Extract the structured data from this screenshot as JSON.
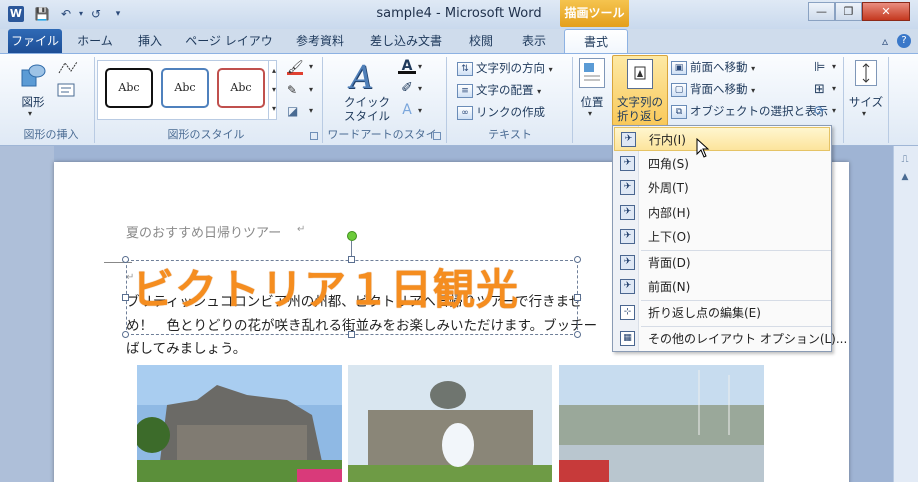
{
  "window": {
    "title": "sample4 - Microsoft Word",
    "contextual_tab_group": "描画ツール",
    "app_icon_label": "W",
    "colors": {
      "ribbon_accent": "#2b579a",
      "contextual": "#f0b232",
      "wordart": "#f58d1f",
      "menu_highlight": "#fce49c"
    }
  },
  "tabs": [
    "ファイル",
    "ホーム",
    "挿入",
    "ページ レイアウト",
    "参考資料",
    "差し込み文書",
    "校閲",
    "表示",
    "書式"
  ],
  "ribbon": {
    "insert_shapes": {
      "shapes_label": "図形",
      "group_label": "図形の挿入"
    },
    "shape_styles": {
      "samples": [
        "Abc",
        "Abc",
        "Abc"
      ],
      "group_label": "図形のスタイル"
    },
    "wordart_styles": {
      "quick_styles_label": "クイック\nスタイル",
      "quick_line1": "クイック",
      "quick_line2": "スタイル",
      "group_label": "ワードアートのスタイル"
    },
    "text": {
      "text_direction": "文字列の方向",
      "align_text": "文字の配置",
      "create_link": "リンクの作成",
      "group_label": "テキスト"
    },
    "arrange": {
      "position": "位置",
      "wrap_text_line1": "文字列の",
      "wrap_text_line2": "折り返し",
      "bring_forward": "前面へ移動",
      "send_backward": "背面へ移動",
      "selection_pane": "オブジェクトの選択と表示"
    },
    "size": {
      "label": "サイズ"
    }
  },
  "document": {
    "subtitle": "夏のおすすめ日帰りツアー",
    "wordart": "ビクトリア１日観光",
    "body_line1": "ブリティッシュコロンビア州の州都、ビクトリアへ日帰りツアーで行きませ",
    "body_line2": "め！　色とりどりの花が咲き乱れる街並みをお楽しみいただけます。ブッチー",
    "body_line3": "ばしてみましょう。"
  },
  "wrap_menu": {
    "items": [
      {
        "label": "行内(I)",
        "icon": "inline-wrap-icon",
        "highlighted": true
      },
      {
        "label": "四角(S)",
        "icon": "square-wrap-icon"
      },
      {
        "label": "外周(T)",
        "icon": "tight-wrap-icon"
      },
      {
        "label": "内部(H)",
        "icon": "through-wrap-icon"
      },
      {
        "label": "上下(O)",
        "icon": "top-bottom-wrap-icon"
      },
      {
        "label": "背面(D)",
        "icon": "behind-text-icon"
      },
      {
        "label": "前面(N)",
        "icon": "in-front-text-icon"
      },
      {
        "label": "折り返し点の編集(E)",
        "icon": "edit-wrap-points-icon"
      },
      {
        "label": "その他のレイアウト オプション(L)...",
        "icon": "more-layout-options-icon"
      }
    ]
  }
}
